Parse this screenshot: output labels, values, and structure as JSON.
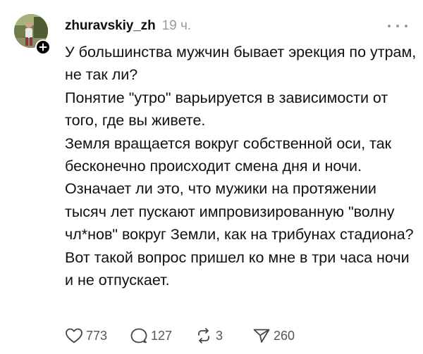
{
  "post": {
    "username": "zhuravskiy_zh",
    "time": "19 ч.",
    "paragraphs": [
      "У большинства мужчин бывает эрекция по утрам, не так ли?",
      "Понятие \"утро\" варьируется в зависимости от того, где вы живете.",
      "Земля вращается вокруг собственной оси, так бесконечно происходит смена дня и ночи.",
      "Означает ли это, что мужики на протяжении тысяч лет пускают импровизированную \"волну чл*нов\" вокруг Земли, как на трибунах стадиона? Вот такой вопрос пришел ко мне в три часа ночи и не отпускает."
    ]
  },
  "actions": {
    "likes": "773",
    "replies": "127",
    "reposts": "3",
    "shares": "260"
  },
  "icons": {
    "like": "heart-icon",
    "reply": "speech-bubble-icon",
    "repost": "repost-arrows-icon",
    "share": "paper-plane-icon",
    "more": "more-dots-icon",
    "follow": "plus-icon"
  },
  "colors": {
    "text": "#101010",
    "muted": "#9a9a9a",
    "action_text": "#555555",
    "badge": "#000000"
  }
}
